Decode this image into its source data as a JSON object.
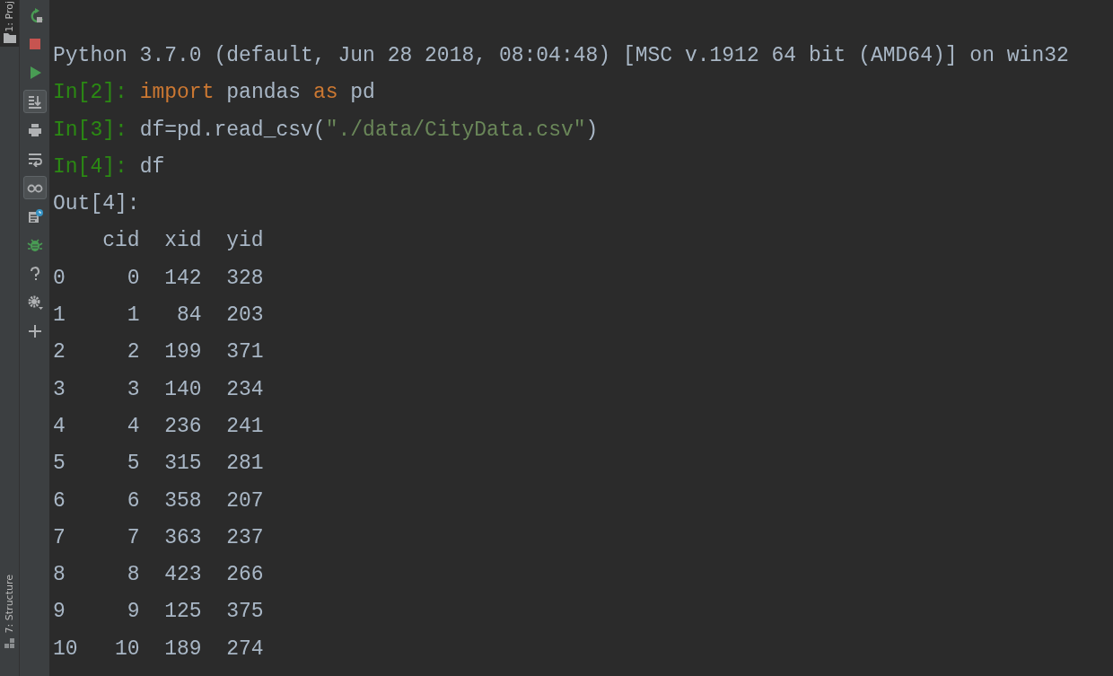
{
  "tool_stripe": {
    "top_tab": "1: Proj",
    "bottom_tab": "7: Structure"
  },
  "toolbar": [
    {
      "kind": "rerun",
      "on": false
    },
    {
      "kind": "stop",
      "on": false
    },
    {
      "kind": "run",
      "on": false
    },
    {
      "kind": "scroll-end",
      "on": true
    },
    {
      "kind": "print",
      "on": false
    },
    {
      "kind": "wrap",
      "on": false
    },
    {
      "kind": "glasses",
      "on": true
    },
    {
      "kind": "history",
      "on": false
    },
    {
      "kind": "bug",
      "on": false
    },
    {
      "kind": "help",
      "on": false
    },
    {
      "kind": "gear",
      "on": false
    },
    {
      "kind": "plus",
      "on": false
    }
  ],
  "console": {
    "lines": [
      {
        "kind": "banner",
        "text": "Python 3.7.0 (default, Jun 28 2018, 08:04:48) [MSC v.1912 64 bit (AMD64)] on win32"
      },
      {
        "kind": "input",
        "prompt": "In[2]:",
        "tokens": [
          {
            "kind": "keyword",
            "text": "import"
          },
          {
            "kind": "plain",
            "text": " pandas "
          },
          {
            "kind": "keyword",
            "text": "as"
          },
          {
            "kind": "plain",
            "text": " pd"
          }
        ]
      },
      {
        "kind": "input",
        "prompt": "In[3]:",
        "tokens": [
          {
            "kind": "plain",
            "text": "df=pd.read_csv("
          },
          {
            "kind": "string",
            "text": "\"./data/CityData.csv\""
          },
          {
            "kind": "plain",
            "text": ")"
          }
        ]
      },
      {
        "kind": "input",
        "prompt": "In[4]:",
        "tokens": [
          {
            "kind": "plain",
            "text": "df"
          }
        ]
      },
      {
        "kind": "output",
        "text": "Out[4]:"
      }
    ],
    "table": {
      "columns": [
        "",
        "cid",
        "xid",
        "yid"
      ],
      "rows": [
        [
          "0",
          "0",
          "142",
          "328"
        ],
        [
          "1",
          "1",
          "84",
          "203"
        ],
        [
          "2",
          "2",
          "199",
          "371"
        ],
        [
          "3",
          "3",
          "140",
          "234"
        ],
        [
          "4",
          "4",
          "236",
          "241"
        ],
        [
          "5",
          "5",
          "315",
          "281"
        ],
        [
          "6",
          "6",
          "358",
          "207"
        ],
        [
          "7",
          "7",
          "363",
          "237"
        ],
        [
          "8",
          "8",
          "423",
          "266"
        ],
        [
          "9",
          "9",
          "125",
          "375"
        ],
        [
          "10",
          "10",
          "189",
          "274"
        ]
      ]
    }
  }
}
